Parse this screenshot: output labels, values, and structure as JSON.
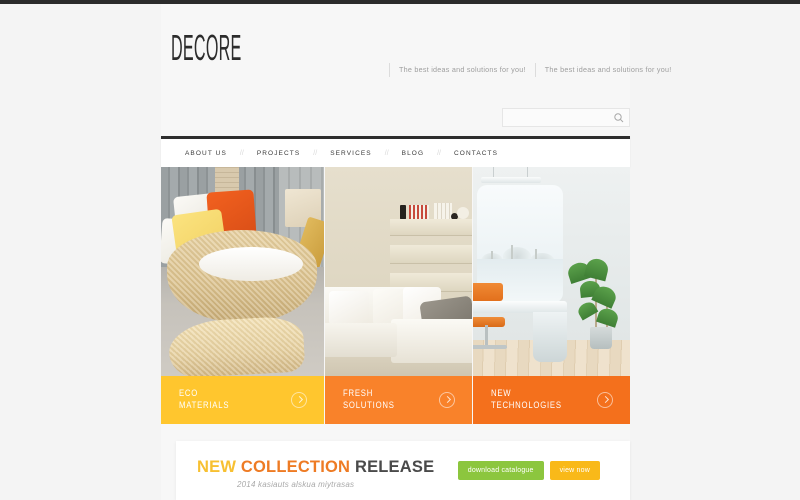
{
  "site": {
    "logo": "DECORE",
    "taglines": [
      "The best ideas and solutions for you!",
      "The best ideas and solutions for you!"
    ]
  },
  "search": {
    "value": "",
    "placeholder": "",
    "icon": "search-icon"
  },
  "nav": {
    "separator": "//",
    "items": [
      {
        "label": "ABOUT US"
      },
      {
        "label": "PROJECTS"
      },
      {
        "label": "SERVICES"
      },
      {
        "label": "BLOG"
      },
      {
        "label": "CONTACTS"
      }
    ]
  },
  "panels": [
    {
      "title": "ECO\nMATERIALS",
      "color": "#FFC62E",
      "arrow_icon": "chevron-right-circle-icon",
      "image_alt": "rattan wicker sofa with orange and yellow cushions"
    },
    {
      "title": "FRESH\nSOLUTIONS",
      "color": "#F9822A",
      "arrow_icon": "chevron-right-circle-icon",
      "image_alt": "beige living room with white sectional sofa and floating shelves"
    },
    {
      "title": "NEW\nTECHNOLOGIES",
      "color": "#F4701C",
      "arrow_icon": "chevron-right-circle-icon",
      "image_alt": "white office desk with orange chair, snowy window and palm plants"
    }
  ],
  "promo": {
    "title_part1": "NEW",
    "title_part2": "COLLECTION",
    "title_part3": "RELEASE",
    "title_color1": "#F7C032",
    "title_color2": "#EE7B24",
    "title_color3": "#4A4A4A",
    "subtitle": "2014 kasiauts alskua miytrasas",
    "buttons": [
      {
        "label": "download catalogue",
        "color": "#8CC63E"
      },
      {
        "label": "view now",
        "color": "#F9B919"
      }
    ]
  }
}
